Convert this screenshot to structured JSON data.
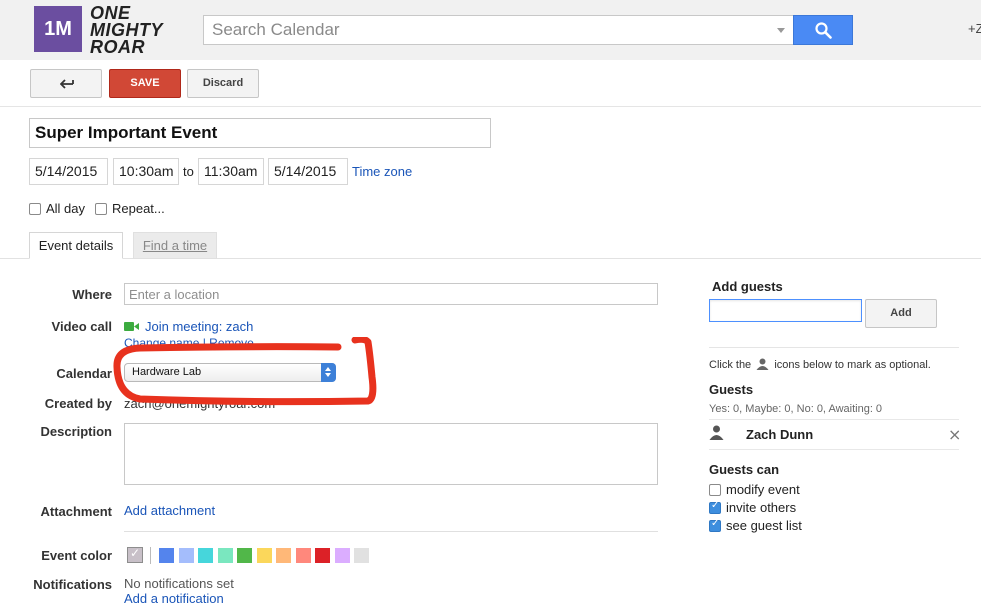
{
  "header": {
    "logo_mark": "1M",
    "logo_lines": [
      "ONE",
      "MIGHTY",
      "ROAR"
    ],
    "search_placeholder": "Search Calendar",
    "top_right_text": "+Z"
  },
  "toolbar": {
    "back_icon": "back-arrow-icon",
    "save_label": "SAVE",
    "discard_label": "Discard"
  },
  "event": {
    "title": "Super Important Event",
    "start_date": "5/14/2015",
    "start_time": "10:30am",
    "to_label": "to",
    "end_time": "11:30am",
    "end_date": "5/14/2015",
    "timezone_link": "Time zone",
    "all_day_label": "All day",
    "all_day_checked": false,
    "repeat_label": "Repeat...",
    "repeat_checked": false
  },
  "tabs": [
    {
      "label": "Event details",
      "active": true
    },
    {
      "label": "Find a time",
      "active": false
    }
  ],
  "details": {
    "where_label": "Where",
    "where_placeholder": "Enter a location",
    "video_label": "Video call",
    "video_icon": "video-camera-icon",
    "join_link": "Join meeting: zach",
    "change_name_link": "Change name | Remove",
    "calendar_label": "Calendar",
    "calendar_value": "Hardware Lab",
    "created_by_label": "Created by",
    "created_by_value": "zach@onemightyroar.com",
    "description_label": "Description",
    "attachment_label": "Attachment",
    "attachment_link": "Add attachment",
    "color_label": "Event color",
    "colors": [
      "#c8c0c8",
      "#5484ed",
      "#a4bdfc",
      "#46d6db",
      "#7ae7bf",
      "#51b749",
      "#fbd75b",
      "#ffb878",
      "#ff887c",
      "#dc2127",
      "#dbadff",
      "#e1e1e1"
    ],
    "notifications_label": "Notifications",
    "notifications_text": "No notifications set",
    "notifications_link": "Add a notification"
  },
  "guests": {
    "add_title": "Add guests",
    "add_button": "Add",
    "optional_hint_prefix": "Click the",
    "optional_hint_suffix": "icons below to mark as optional.",
    "guests_title": "Guests",
    "counts": "Yes: 0, Maybe: 0, No: 0, Awaiting: 0",
    "list": [
      {
        "name": "Zach Dunn"
      }
    ],
    "can_title": "Guests can",
    "permissions": [
      {
        "label": "modify event",
        "checked": false
      },
      {
        "label": "invite others",
        "checked": true
      },
      {
        "label": "see guest list",
        "checked": true
      }
    ]
  },
  "annotation": {
    "color": "#e8321e"
  }
}
